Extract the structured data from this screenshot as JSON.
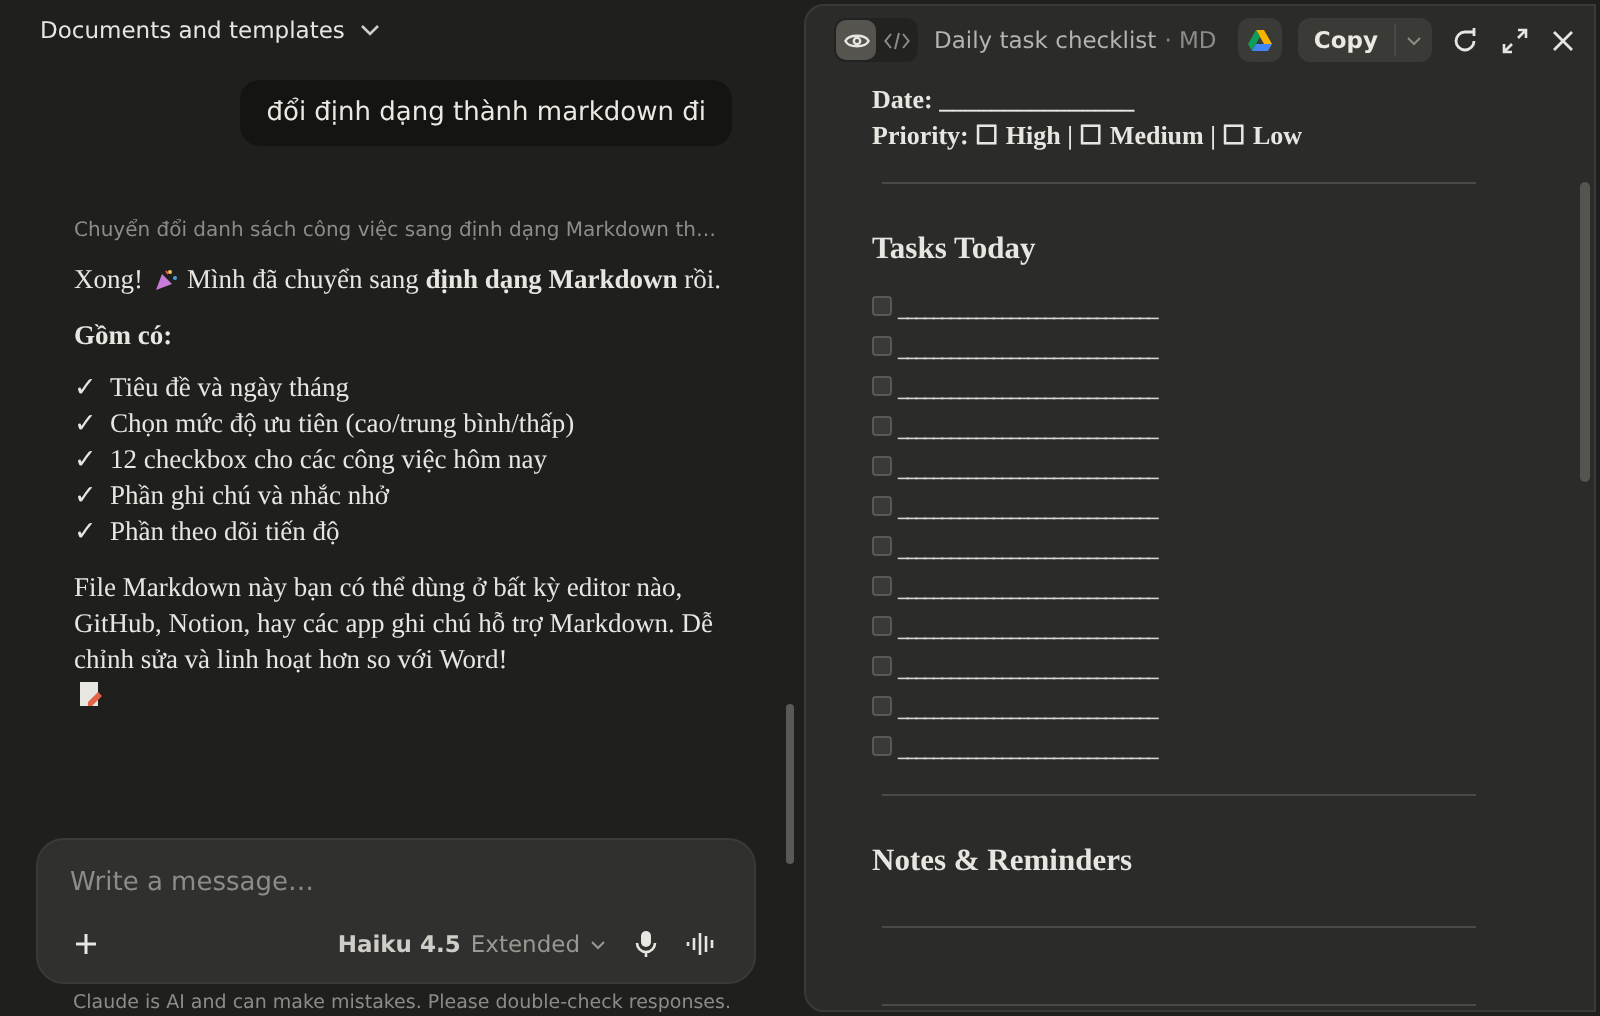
{
  "chat": {
    "header": "Documents and templates",
    "user_message": "đổi định dạng thành markdown đi",
    "thinking_summary": "Chuyển đổi danh sách công việc sang định dạng Markdown th…",
    "reply": {
      "intro": "Xong!",
      "lead": "Mình đã chuyển sang **định dạng Markdown** rồi.",
      "section": "Gồm có:",
      "items": [
        {
          "mark": "✓",
          "text": "Tiêu đề và ngày tháng"
        },
        {
          "mark": "✓",
          "text": "Chọn mức độ ưu tiên (cao/trung bình/thấp)"
        },
        {
          "mark": "✓",
          "text": "12 checkbox cho các công việc hôm nay"
        },
        {
          "mark": "✓",
          "text": "Phần ghi chú và nhắc nhở"
        },
        {
          "mark": "✓",
          "text": "Phần theo dõi tiến độ"
        }
      ],
      "closing": "File Markdown này bạn có thể dùng ở bất kỳ editor nào, GitHub, Notion, hay các app ghi chú hỗ trợ Markdown. Dễ chỉnh sửa và linh hoạt hơn so với Word!"
    },
    "composer": {
      "placeholder": "Write a message…",
      "model": "Haiku 4.5",
      "mode": "Extended"
    },
    "disclaimer": "Claude is AI and can make mistakes. Please double-check responses."
  },
  "artifact": {
    "view_toggle": [
      {
        "kind": "preview",
        "selected": true
      },
      {
        "kind": "code",
        "selected": false
      }
    ],
    "title": "Daily task checklist",
    "format": "· MD",
    "copy_label": "Copy",
    "document": [
      {
        "kind": "field",
        "text": "Date: _______________"
      },
      {
        "kind": "field",
        "text": "Priority: ☐ High | ☐ Medium | ☐ Low"
      },
      {
        "kind": "rule"
      },
      {
        "kind": "heading",
        "text": "Tasks Today"
      },
      {
        "kind": "task",
        "checked": false,
        "text": "______________________________"
      },
      {
        "kind": "task",
        "checked": false,
        "text": "______________________________"
      },
      {
        "kind": "task",
        "checked": false,
        "text": "______________________________"
      },
      {
        "kind": "task",
        "checked": false,
        "text": "______________________________"
      },
      {
        "kind": "task",
        "checked": false,
        "text": "______________________________"
      },
      {
        "kind": "task",
        "checked": false,
        "text": "______________________________"
      },
      {
        "kind": "task",
        "checked": false,
        "text": "______________________________"
      },
      {
        "kind": "task",
        "checked": false,
        "text": "______________________________"
      },
      {
        "kind": "task",
        "checked": false,
        "text": "______________________________"
      },
      {
        "kind": "task",
        "checked": false,
        "text": "______________________________"
      },
      {
        "kind": "task",
        "checked": false,
        "text": "______________________________"
      },
      {
        "kind": "task",
        "checked": false,
        "text": "______________________________"
      },
      {
        "kind": "rule"
      },
      {
        "kind": "heading",
        "text": "Notes & Reminders"
      },
      {
        "kind": "rule"
      },
      {
        "kind": "rule"
      }
    ]
  }
}
